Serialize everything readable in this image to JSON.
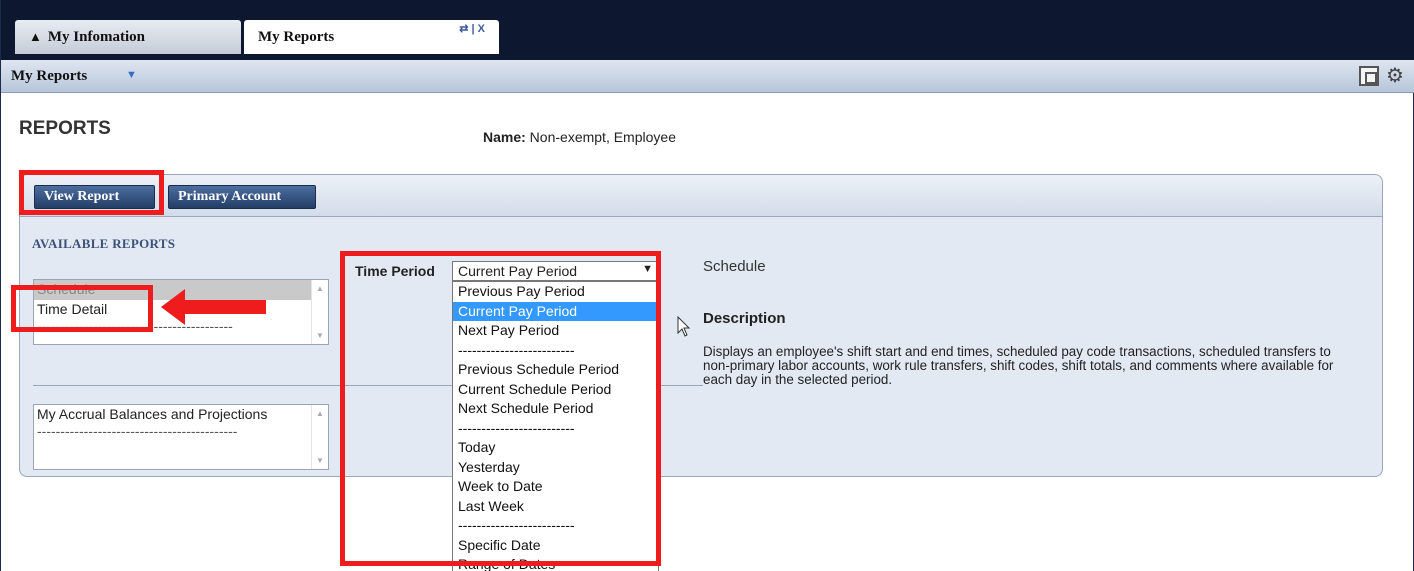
{
  "tabs": {
    "info_label": "My Infomation",
    "reports_label": "My Reports",
    "tools_label": "⇄ | X"
  },
  "subbar": {
    "title": "My Reports"
  },
  "page": {
    "heading": "REPORTS",
    "name_label": "Name:",
    "name_value": " Non-exempt, Employee"
  },
  "buttons": {
    "view_report": "View Report",
    "primary_account": "Primary Account"
  },
  "available": {
    "heading": "AVAILABLE REPORTS",
    "list1": [
      "Schedule",
      "Time Detail",
      "------------------------------------------"
    ],
    "list2": [
      "My Accrual Balances and Projections",
      "-------------------------------------------"
    ]
  },
  "time_period": {
    "label": "Time Period",
    "selected": "Current Pay Period",
    "options": [
      "Previous Pay Period",
      "Current Pay Period",
      "Next Pay Period",
      "-------------------------",
      "Previous Schedule Period",
      "Current Schedule Period",
      "Next Schedule Period",
      "-------------------------",
      "Today",
      "Yesterday",
      "Week to Date",
      "Last Week",
      "-------------------------",
      "Specific Date",
      "Range of Dates"
    ],
    "active_index": 1
  },
  "detail": {
    "report_name": "Schedule",
    "description_heading": "Description",
    "description_text": "Displays an employee's shift start and end times, scheduled pay code transactions, scheduled transfers to non-primary labor accounts, work rule transfers, shift codes, shift totals, and comments where available for each day in the selected period."
  },
  "colors": {
    "annotation_red": "#ee1c1c",
    "highlight_blue": "#3399ff",
    "header_navy": "#0d1830"
  }
}
